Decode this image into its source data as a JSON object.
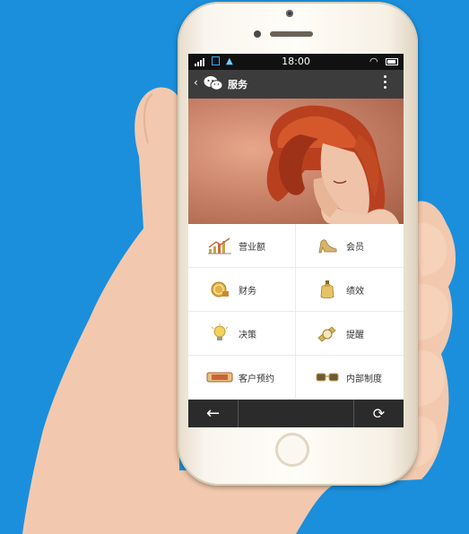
{
  "status_bar": {
    "time": "18:00"
  },
  "nav": {
    "back_glyph": "‹",
    "title": "服务",
    "menu_icon": "more-vertical-icon"
  },
  "grid": {
    "items": [
      {
        "label": "营业额",
        "icon": "revenue-chart-icon"
      },
      {
        "label": "会员",
        "icon": "high-heel-icon"
      },
      {
        "label": "财务",
        "icon": "coin-icon"
      },
      {
        "label": "绩效",
        "icon": "perfume-bottle-icon"
      },
      {
        "label": "决策",
        "icon": "light-bulb-icon"
      },
      {
        "label": "提醒",
        "icon": "watch-icon"
      },
      {
        "label": "客户预约",
        "icon": "voucher-ticket-icon"
      },
      {
        "label": "内部制度",
        "icon": "glasses-icon"
      }
    ]
  },
  "toolbar": {
    "back_glyph": "←",
    "refresh_glyph": "⟳"
  },
  "colors": {
    "background": "#1b8fdc",
    "navbar": "#3c3c3c",
    "toolbar": "#2b2b2b",
    "icon_gold": "#c9a24a"
  }
}
